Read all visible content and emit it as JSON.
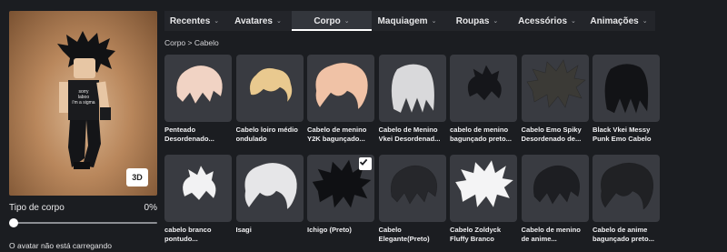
{
  "tabs": [
    {
      "label": "Recentes",
      "active": false
    },
    {
      "label": "Avatares",
      "active": false
    },
    {
      "label": "Corpo",
      "active": true
    },
    {
      "label": "Maquiagem",
      "active": false
    },
    {
      "label": "Roupas",
      "active": false
    },
    {
      "label": "Acessórios",
      "active": false
    },
    {
      "label": "Animações",
      "active": false
    }
  ],
  "breadcrumb": "Corpo > Cabelo",
  "avatar": {
    "view_button": "3D",
    "body_type_label": "Tipo de corpo",
    "body_type_value": "0%",
    "status": "O avatar não está carregando",
    "shirt_text": "sorry\nlaboo\ni'm a sigma"
  },
  "colors": {
    "accent": "#ffffff",
    "tile": "#393b41",
    "background": "#1b1d21"
  },
  "items": [
    {
      "name": "Penteado Desordenado...",
      "hair_color": "#f1d3c4",
      "style": "fluffy",
      "selected": false
    },
    {
      "name": "Cabelo loiro médio ondulado",
      "hair_color": "#e9c98f",
      "style": "wavy",
      "selected": false
    },
    {
      "name": "Cabelo de menino Y2K bagunçado...",
      "hair_color": "#f0c2a6",
      "style": "big",
      "selected": false
    },
    {
      "name": "Cabelo de Menino Vkei Desordenad...",
      "hair_color": "#d9d9db",
      "style": "long",
      "selected": false
    },
    {
      "name": "cabelo de menino bagunçado preto...",
      "hair_color": "#15161a",
      "style": "small",
      "selected": false
    },
    {
      "name": "Cabelo Emo Spiky Desordenado de...",
      "hair_color": "#3b3a36",
      "style": "spiky",
      "selected": false
    },
    {
      "name": "Black Vkei Messy Punk Emo Cabelo",
      "hair_color": "#121316",
      "style": "long",
      "selected": false
    },
    {
      "name": "cabelo branco pontudo...",
      "hair_color": "#f2f2f3",
      "style": "small",
      "selected": false
    },
    {
      "name": "Isagi",
      "hair_color": "#e6e6e8",
      "style": "big",
      "selected": false
    },
    {
      "name": "Ichigo (Preto)",
      "hair_color": "#0f1013",
      "style": "spiky",
      "selected": true
    },
    {
      "name": "Cabelo Elegante(Preto)",
      "hair_color": "#26272b",
      "style": "fluffy",
      "selected": false
    },
    {
      "name": "Cabelo Zoldyck Fluffy Branco",
      "hair_color": "#f4f4f5",
      "style": "spiky",
      "selected": false
    },
    {
      "name": "Cabelo de menino de anime...",
      "hair_color": "#1d1e22",
      "style": "fluffy",
      "selected": false
    },
    {
      "name": "Cabelo de anime bagunçado preto...",
      "hair_color": "#202124",
      "style": "big",
      "selected": false
    }
  ]
}
